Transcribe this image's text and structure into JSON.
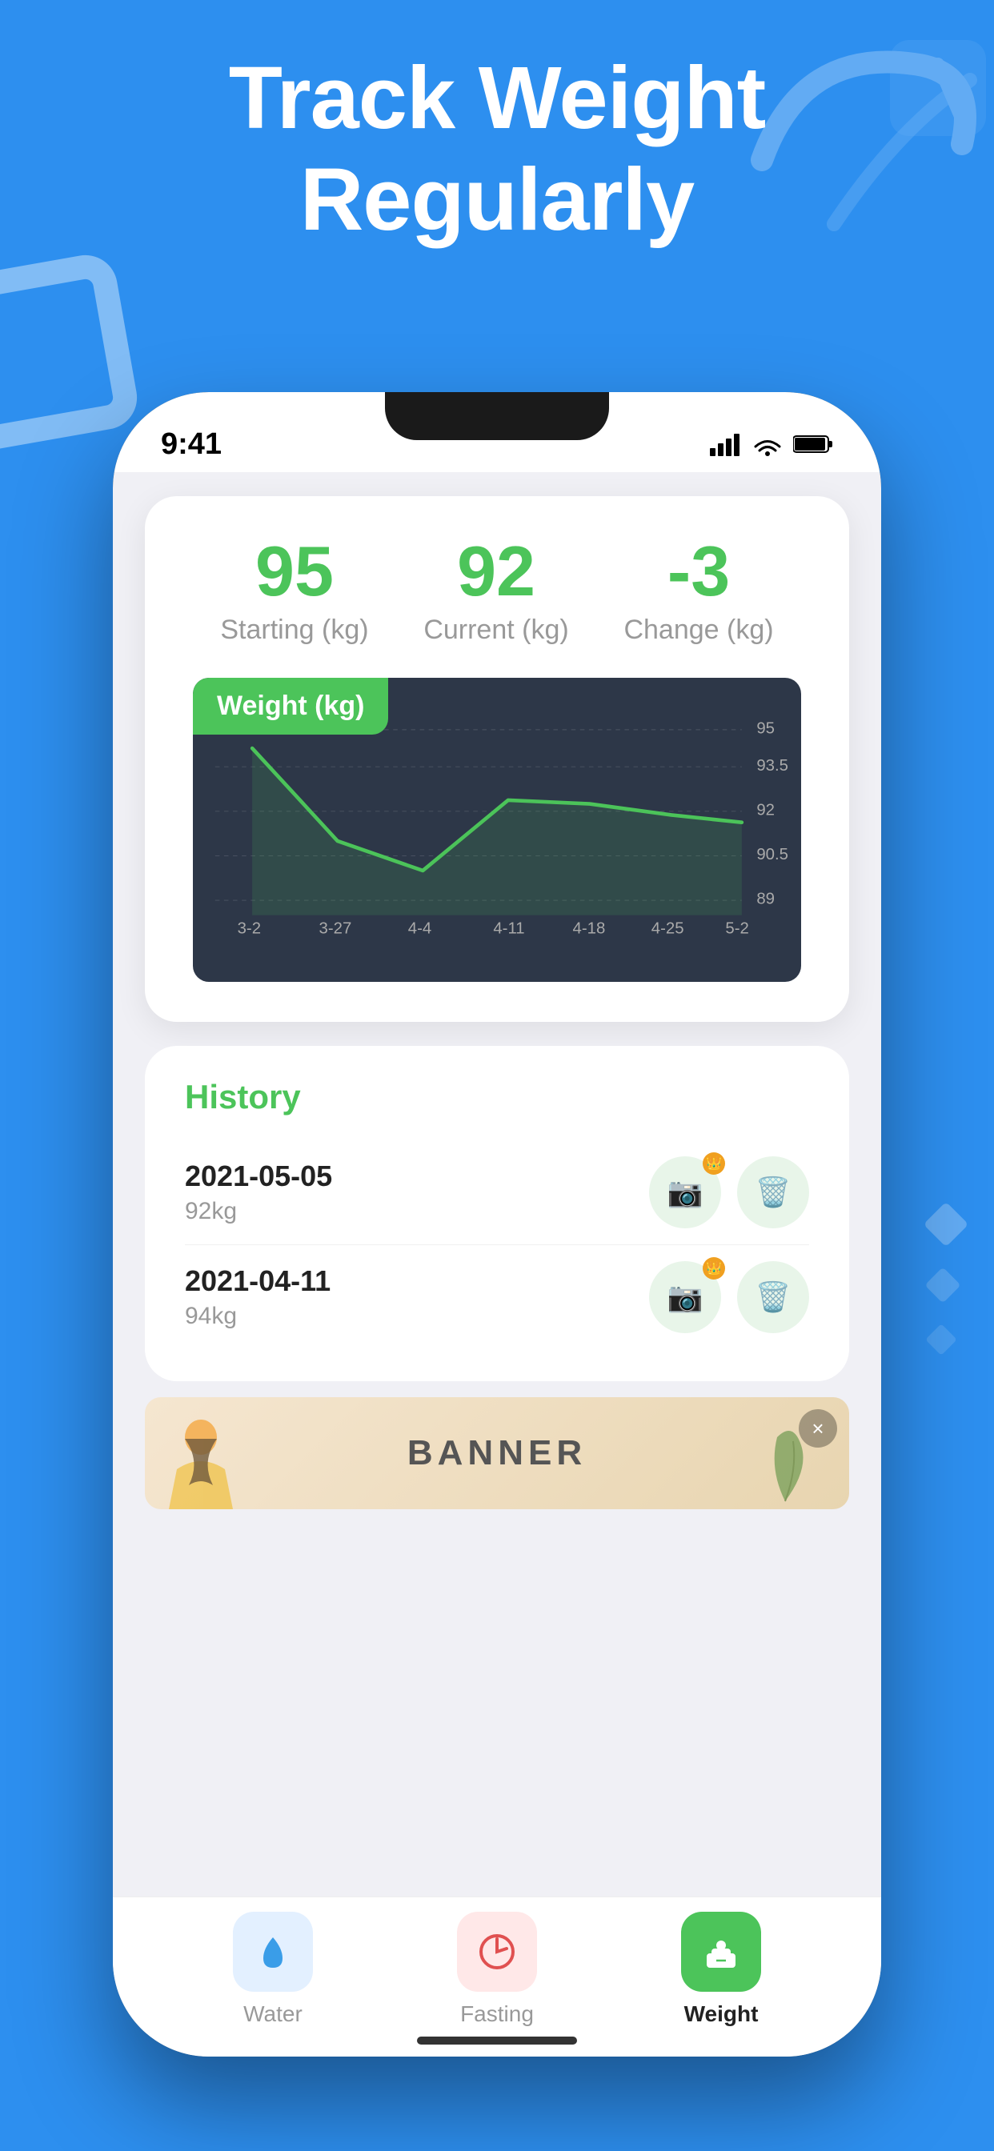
{
  "hero": {
    "title_line1": "Track Weight",
    "title_line2": "Regularly",
    "background_color": "#2d8fef"
  },
  "status_bar": {
    "time": "9:41",
    "signal_bars": "▂▄▆█",
    "wifi": "wifi",
    "battery": "battery"
  },
  "stats": {
    "starting_value": "95",
    "starting_label": "Starting (kg)",
    "current_value": "92",
    "current_label": "Current (kg)",
    "change_value": "-3",
    "change_label": "Change (kg)"
  },
  "chart": {
    "label": "Weight  (kg)",
    "y_labels": [
      "95",
      "93.5",
      "92",
      "90.5",
      "89"
    ],
    "x_labels": [
      "3-2",
      "3-27",
      "4-4",
      "4-11",
      "4-18",
      "4-25",
      "5-2"
    ]
  },
  "history": {
    "title": "History",
    "items": [
      {
        "date": "2021-05-05",
        "weight": "92kg"
      },
      {
        "date": "2021-04-11",
        "weight": "94kg"
      }
    ]
  },
  "banner": {
    "text": "BANNER",
    "close_label": "×"
  },
  "tabs": [
    {
      "id": "water",
      "label": "Water",
      "active": false,
      "icon_color": "#3a9de8",
      "bg_color": "#e3f0ff"
    },
    {
      "id": "fasting",
      "label": "Fasting",
      "active": false,
      "icon_color": "#e05050",
      "bg_color": "#ffe8e8"
    },
    {
      "id": "weight",
      "label": "Weight",
      "active": true,
      "icon_color": "white",
      "bg_color": "#4cc45a"
    }
  ],
  "colors": {
    "accent_green": "#4cc45a",
    "accent_blue": "#2d8fef",
    "chart_bg": "#2d3748",
    "chart_line": "#4cc45a"
  }
}
